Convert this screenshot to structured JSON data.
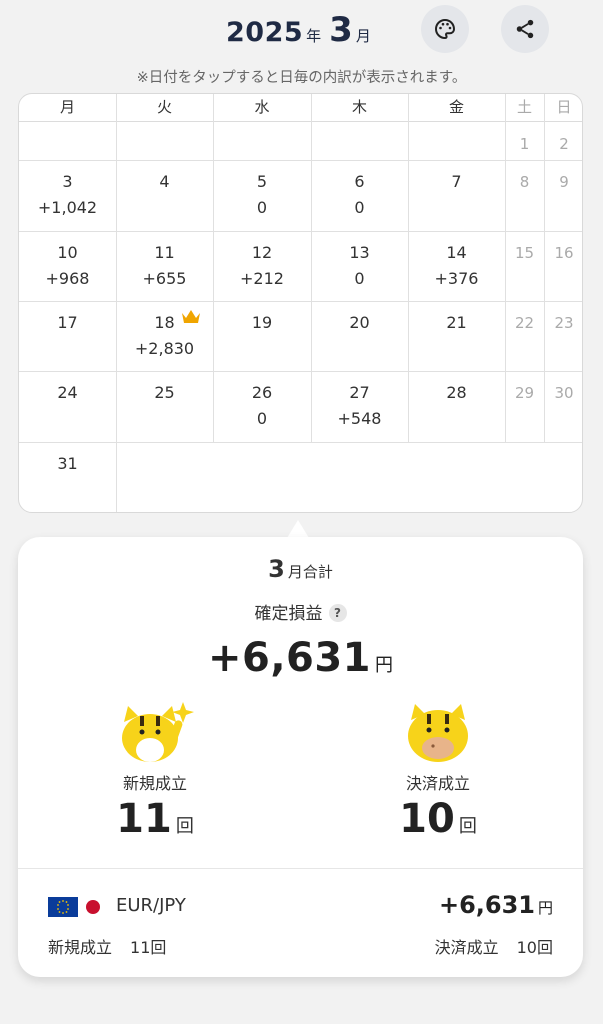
{
  "header": {
    "year": "2025",
    "year_unit": "年",
    "month": "3",
    "month_unit": "月",
    "palette_button_icon": "palette-icon",
    "share_button_icon": "share-icon"
  },
  "hint": "※日付をタップすると日毎の内訳が表示されます。",
  "calendar": {
    "weekdays": [
      "月",
      "火",
      "水",
      "木",
      "金",
      "土",
      "日"
    ],
    "weeks": [
      [
        null,
        null,
        null,
        null,
        null,
        {
          "d": "1",
          "v": ""
        },
        {
          "d": "2",
          "v": ""
        }
      ],
      [
        {
          "d": "3",
          "v": "+1,042"
        },
        {
          "d": "4",
          "v": ""
        },
        {
          "d": "5",
          "v": "0"
        },
        {
          "d": "6",
          "v": "0"
        },
        {
          "d": "7",
          "v": ""
        },
        {
          "d": "8",
          "v": ""
        },
        {
          "d": "9",
          "v": ""
        }
      ],
      [
        {
          "d": "10",
          "v": "+968"
        },
        {
          "d": "11",
          "v": "+655"
        },
        {
          "d": "12",
          "v": "+212"
        },
        {
          "d": "13",
          "v": "0"
        },
        {
          "d": "14",
          "v": "+376"
        },
        {
          "d": "15",
          "v": ""
        },
        {
          "d": "16",
          "v": ""
        }
      ],
      [
        {
          "d": "17",
          "v": ""
        },
        {
          "d": "18",
          "v": "+2,830",
          "crown": true
        },
        {
          "d": "19",
          "v": ""
        },
        {
          "d": "20",
          "v": ""
        },
        {
          "d": "21",
          "v": ""
        },
        {
          "d": "22",
          "v": ""
        },
        {
          "d": "23",
          "v": ""
        }
      ],
      [
        {
          "d": "24",
          "v": ""
        },
        {
          "d": "25",
          "v": ""
        },
        {
          "d": "26",
          "v": "0"
        },
        {
          "d": "27",
          "v": "+548"
        },
        {
          "d": "28",
          "v": ""
        },
        {
          "d": "29",
          "v": ""
        },
        {
          "d": "30",
          "v": ""
        }
      ],
      [
        {
          "d": "31",
          "v": ""
        },
        null,
        null,
        null,
        null,
        null,
        null
      ]
    ],
    "crown_color": "#f0a500"
  },
  "summary": {
    "month": "3",
    "title_suffix": "月合計",
    "pl_label": "確定損益",
    "help_mark": "?",
    "pl_amount": "+6,631",
    "pl_unit": "円",
    "new_label": "新規成立",
    "new_count": "11",
    "count_unit": "回",
    "close_label": "決済成立",
    "close_count": "10",
    "mascot_color": "#f7d31a"
  },
  "pair": {
    "name": "EUR/JPY",
    "amount": "+6,631",
    "unit": "円",
    "new_label": "新規成立",
    "new_count": "11回",
    "close_label": "決済成立",
    "close_count": "10回"
  }
}
